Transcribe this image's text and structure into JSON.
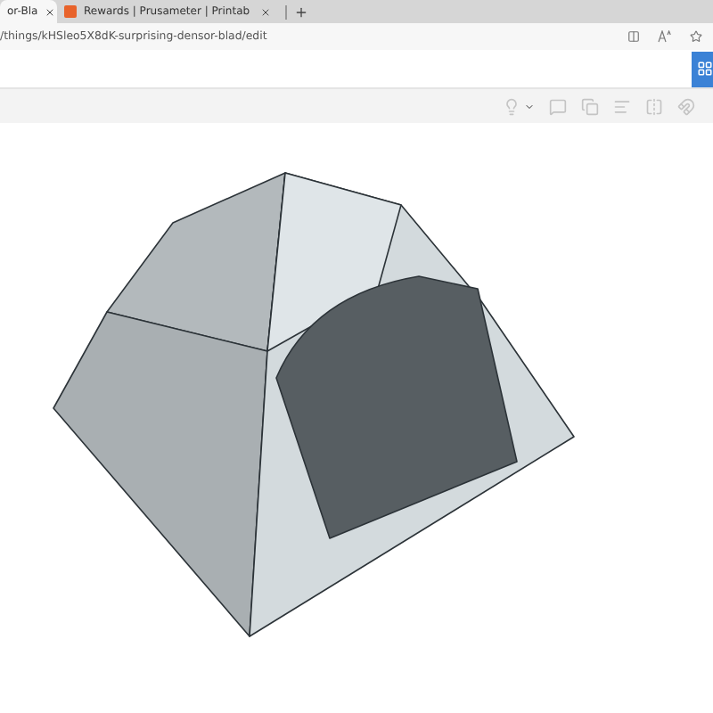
{
  "tabs": [
    {
      "label": "or-Bla",
      "selected": true,
      "kind": "plain"
    },
    {
      "label": "Rewards | Prusameter | Printab",
      "selected": false,
      "kind": "site"
    }
  ],
  "address_bar": {
    "url": "/things/kHSleo5X8dK-surprising-densor-blad/edit"
  }
}
